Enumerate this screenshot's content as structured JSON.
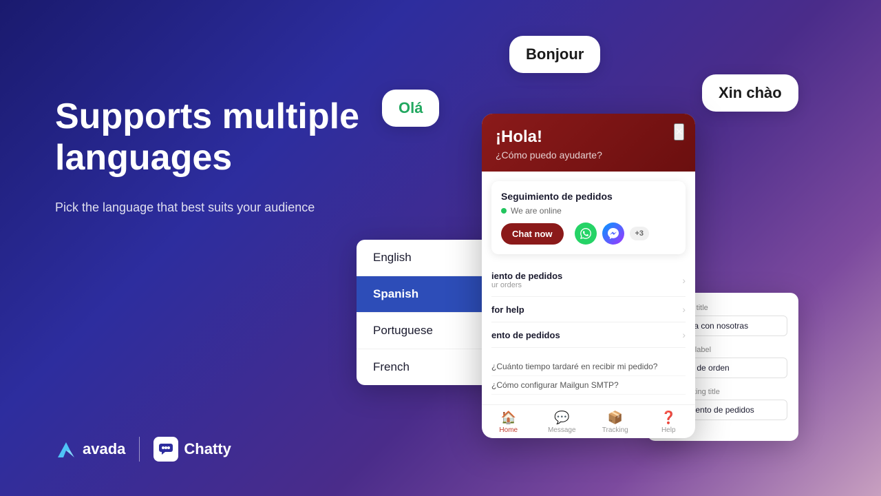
{
  "page": {
    "title": "Supports multiple languages",
    "subtitle": "Pick the language that best suits your audience"
  },
  "bubbles": {
    "bonjour": "Bonjour",
    "ola": "Olá",
    "xinchao": "Xin chào"
  },
  "language_panel": {
    "items": [
      {
        "id": "english",
        "label": "English",
        "active": false
      },
      {
        "id": "spanish",
        "label": "Spanish",
        "active": true
      },
      {
        "id": "portuguese",
        "label": "Portuguese",
        "active": false
      },
      {
        "id": "french",
        "label": "French",
        "active": false
      }
    ]
  },
  "chat_widget": {
    "close_icon": "×",
    "hello": "¡Hola!",
    "subtitle": "¿Cómo puedo ayudarte?",
    "card": {
      "title": "Seguimiento de pedidos",
      "online_text": "We are online",
      "chat_now": "Chat now",
      "icons": {
        "whatsapp": "💬",
        "messenger": "m",
        "plus": "+3"
      }
    },
    "list_items": [
      {
        "title": "iento de pedidos",
        "sub": "ur orders"
      },
      {
        "title": "for help",
        "sub": ""
      },
      {
        "title": "ento de pedidos",
        "sub": ""
      }
    ],
    "questions": [
      "¿Cuánto tiempo tardaré en recibir mi pedido?",
      "¿Cómo configurar Mailgun SMTP?"
    ],
    "nav": [
      {
        "label": "Home",
        "active": true
      },
      {
        "label": "Message",
        "active": false
      },
      {
        "label": "Tracking",
        "active": false
      },
      {
        "label": "Help",
        "active": false
      }
    ]
  },
  "settings_panel": {
    "fields": [
      {
        "label": "Contact us title",
        "value": "Contacta con nosotras"
      },
      {
        "label": "WhatsApp label",
        "value": "Rastreo de orden"
      },
      {
        "label": "Order tracking title",
        "value": "Seguimiento de pedidos"
      }
    ]
  },
  "logos": {
    "avada": "avada",
    "chatty": "Chatty"
  }
}
